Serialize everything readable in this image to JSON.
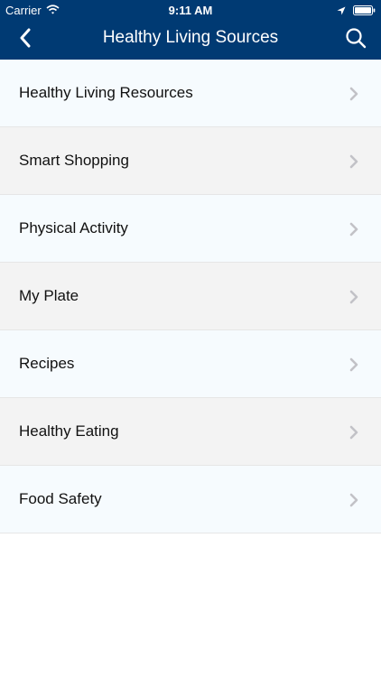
{
  "status_bar": {
    "carrier": "Carrier",
    "time": "9:11 AM"
  },
  "navbar": {
    "title": "Healthy Living Sources",
    "back_icon": "chevron-left-icon",
    "search_icon": "search-icon",
    "background_color": "#003a73"
  },
  "list": {
    "items": [
      {
        "label": "Healthy Living Resources"
      },
      {
        "label": "Smart Shopping"
      },
      {
        "label": "Physical Activity"
      },
      {
        "label": "My Plate"
      },
      {
        "label": "Recipes"
      },
      {
        "label": "Healthy Eating"
      },
      {
        "label": "Food Safety"
      }
    ]
  }
}
